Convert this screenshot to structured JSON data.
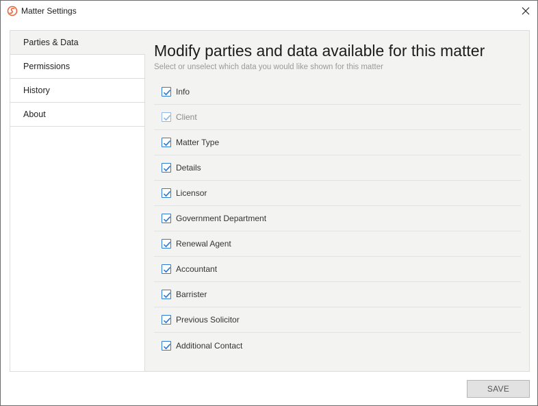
{
  "window": {
    "title": "Matter Settings"
  },
  "sidebar": {
    "items": [
      {
        "label": "Parties & Data",
        "active": true
      },
      {
        "label": "Permissions",
        "active": false
      },
      {
        "label": "History",
        "active": false
      },
      {
        "label": "About",
        "active": false
      }
    ]
  },
  "main": {
    "heading": "Modify parties and data available for this matter",
    "subheading": "Select or unselect which data you would like shown for this matter",
    "options": [
      {
        "label": "Info",
        "checked": true,
        "disabled": false
      },
      {
        "label": "Client",
        "checked": true,
        "disabled": true
      },
      {
        "label": "Matter Type",
        "checked": true,
        "disabled": false
      },
      {
        "label": "Details",
        "checked": true,
        "disabled": false
      },
      {
        "label": "Licensor",
        "checked": true,
        "disabled": false
      },
      {
        "label": "Government Department",
        "checked": true,
        "disabled": false
      },
      {
        "label": "Renewal Agent",
        "checked": true,
        "disabled": false
      },
      {
        "label": "Accountant",
        "checked": true,
        "disabled": false
      },
      {
        "label": "Barrister",
        "checked": true,
        "disabled": false
      },
      {
        "label": "Previous Solicitor",
        "checked": true,
        "disabled": false
      },
      {
        "label": "Additional Contact",
        "checked": true,
        "disabled": false
      }
    ]
  },
  "footer": {
    "save_label": "SAVE"
  },
  "colors": {
    "accent": "#2c7ad6",
    "app_icon": "#e8643c"
  }
}
